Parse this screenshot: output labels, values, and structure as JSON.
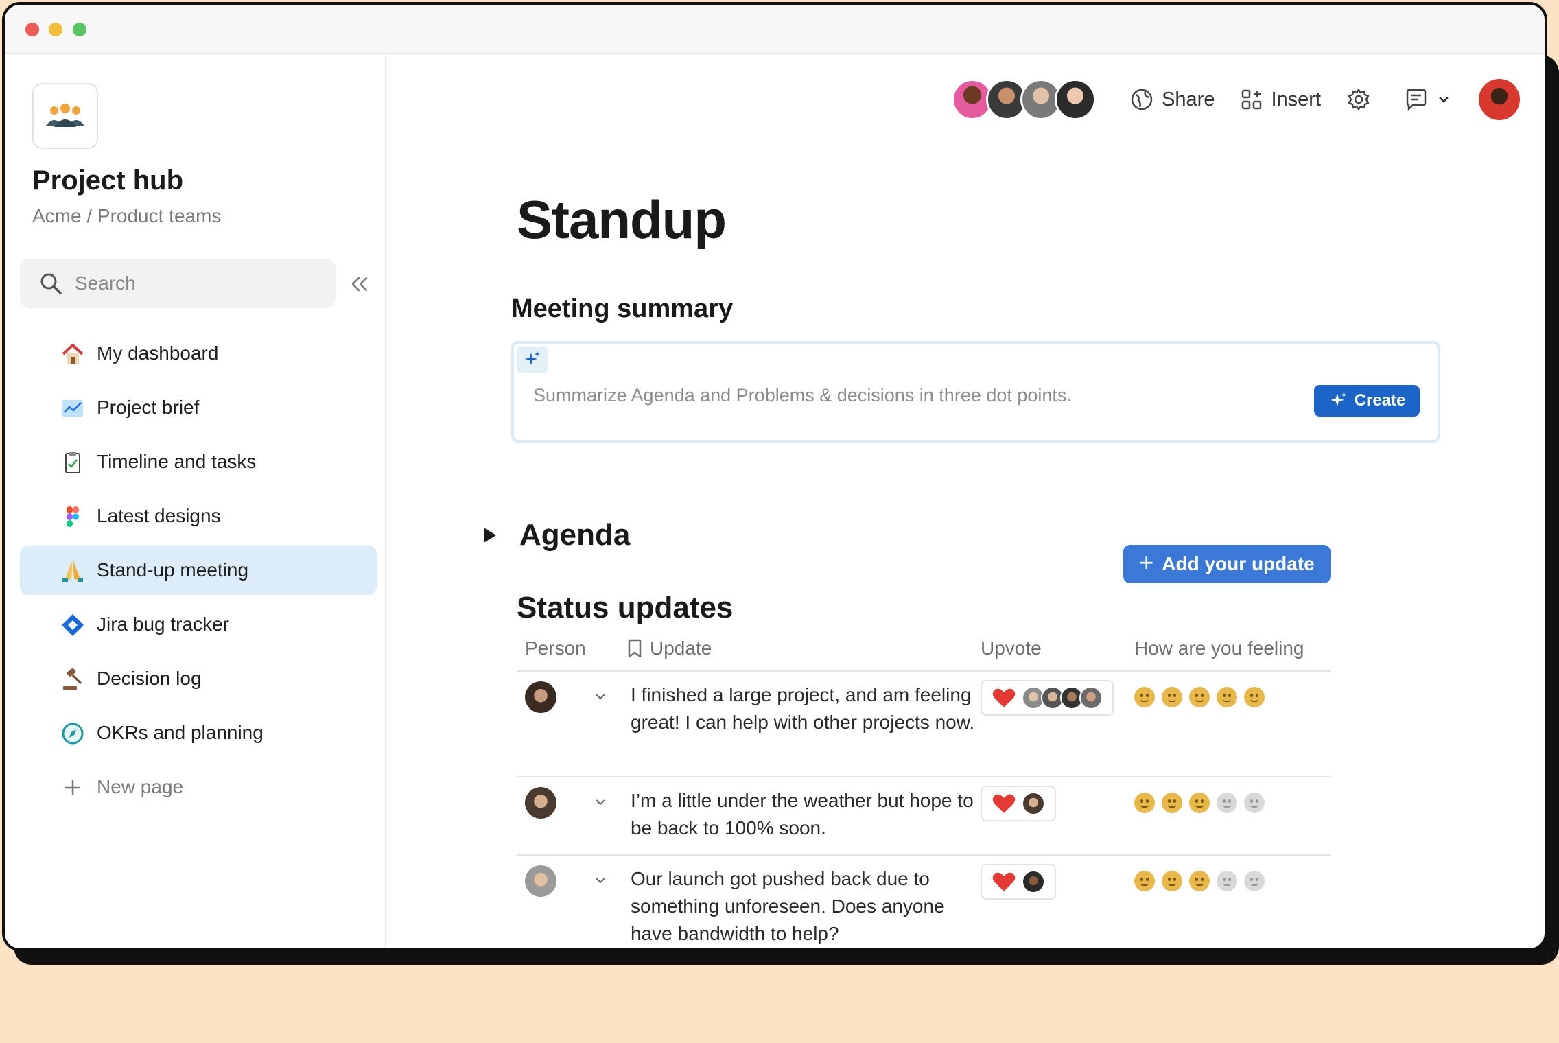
{
  "app": {
    "title": "Project hub",
    "breadcrumb": "Acme / Product teams"
  },
  "sidebar": {
    "search_placeholder": "Search",
    "items": [
      {
        "label": "My dashboard",
        "icon": "house-icon"
      },
      {
        "label": "Project brief",
        "icon": "chart-icon"
      },
      {
        "label": "Timeline and tasks",
        "icon": "clipboard-icon"
      },
      {
        "label": "Latest designs",
        "icon": "figma-icon"
      },
      {
        "label": "Stand-up meeting",
        "icon": "praying-hands-icon",
        "active": true
      },
      {
        "label": "Jira bug tracker",
        "icon": "jira-icon"
      },
      {
        "label": "Decision log",
        "icon": "gavel-icon"
      },
      {
        "label": "OKRs and planning",
        "icon": "compass-icon"
      }
    ],
    "new_page": "New page"
  },
  "topbar": {
    "share_label": "Share",
    "insert_label": "Insert"
  },
  "page": {
    "title": "Standup",
    "meeting_summary_title": "Meeting summary",
    "ai_prompt": "Summarize Agenda and Problems & decisions in three dot points.",
    "ai_create_label": "Create",
    "agenda_label": "Agenda",
    "status_title": "Status updates",
    "add_update_label": "Add your update"
  },
  "table": {
    "headers": {
      "person": "Person",
      "update": "Update",
      "upvote": "Upvote",
      "feeling": "How are you feeling"
    },
    "rows": [
      {
        "text": "I finished a large project, and am feeling great! I can help with other projects now.",
        "feeling": 5
      },
      {
        "text": "I’m a little under the weather but hope to be back to 100% soon.",
        "feeling": 3
      },
      {
        "text": "Our launch got pushed back due to something unforeseen. Does anyone have bandwidth to help?",
        "feeling": 3
      }
    ]
  },
  "colors": {
    "accent": "#3b78d8",
    "create_button": "#1c64c8",
    "active_nav": "#dcedf9",
    "background": "#fde3c6",
    "heart": "#e53935",
    "face_on": "#e8b94a",
    "face_off": "#d9d9d9"
  }
}
